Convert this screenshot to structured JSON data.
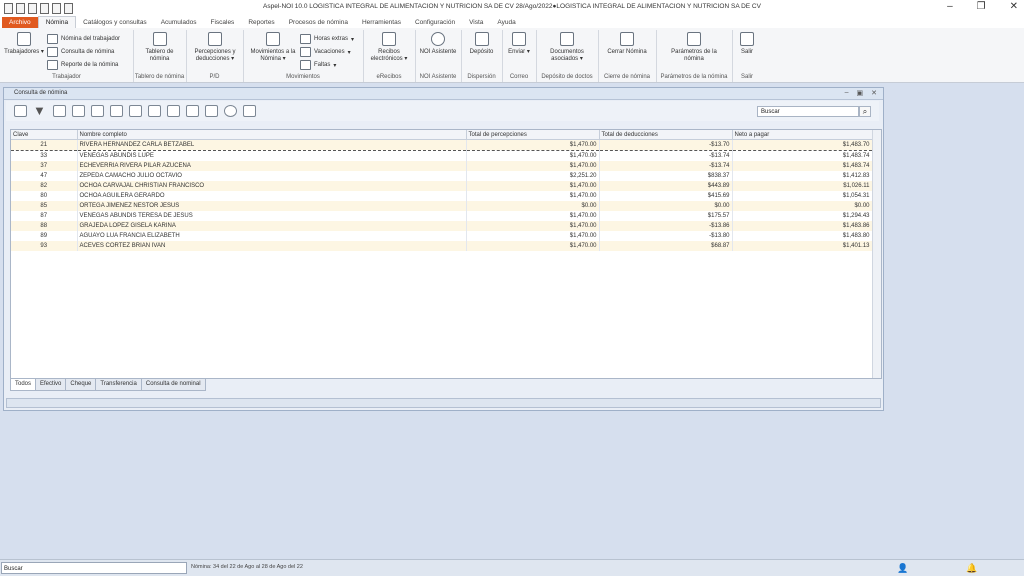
{
  "window": {
    "title": "Aspel-NOI 10.0   LOGISTICA INTEGRAL DE ALIMENTACION Y NUTRICION SA DE CV     28/Ago/2022●LOGISTICA INTEGRAL DE ALIMENTACION Y NUTRICION SA DE CV",
    "minimize": "–",
    "restore": "❐",
    "close": "✕"
  },
  "menu_tabs": [
    "Archivo",
    "Nómina",
    "Catálogos y consultas",
    "Acumulados",
    "Fiscales",
    "Reportes",
    "Procesos de nómina",
    "Herramientas",
    "Configuración",
    "Vista",
    "Ayuda"
  ],
  "ribbon": {
    "trabajador": {
      "trabajadores": "Trabajadores",
      "nomina_trabajador": "Nómina del trabajador",
      "consulta_nomina": "Consulta de nómina",
      "reporte_nomina": "Reporte de la nómina",
      "label": "Trabajador"
    },
    "tablero": {
      "btn": "Tablero de nómina",
      "label": "Tablero de nómina"
    },
    "pd": {
      "btn": "Percepciones y deducciones",
      "label": "P/D"
    },
    "movimientos": {
      "btn": "Movimientos a la Nómina",
      "horas": "Horas extras",
      "vacaciones": "Vacaciones",
      "faltas": "Faltas",
      "label": "Movimientos"
    },
    "recibos": {
      "btn": "Recibos electrónicos",
      "label": "eRecibos"
    },
    "noi": {
      "btn": "NOI Asistente",
      "label": "NOI Asistente"
    },
    "deposito": {
      "btn": "Depósito",
      "label": "Dispersión"
    },
    "enviar": {
      "btn": "Enviar",
      "label": "Correo"
    },
    "documentos": {
      "btn": "Documentos asociados",
      "label": "Depósito de doctos"
    },
    "cerrar": {
      "btn": "Cerrar Nómina",
      "label": "Cierre de nómina"
    },
    "parametros": {
      "btn": "Parámetros de la nómina",
      "label": "Parámetros de la nómina"
    },
    "salir": {
      "btn": "Salir",
      "label": "Salir"
    }
  },
  "panel": {
    "title": "Consulta de nómina",
    "search_placeholder": "Buscar",
    "columns": [
      "Clave",
      "Nombre completo",
      "Total de percepciones",
      "Total de deducciones",
      "Neto a pagar"
    ],
    "rows": [
      [
        "21",
        "RIVERA HERNANDEZ CARLA BETZABEL",
        "$1,470.00",
        "-$13.70",
        "$1,483.70"
      ],
      [
        "33",
        "VENEGAS ABUNDIS LUPE",
        "$1,470.00",
        "-$13.74",
        "$1,483.74"
      ],
      [
        "37",
        "ECHEVERRIA RIVERA PILAR AZUCENA",
        "$1,470.00",
        "-$13.74",
        "$1,483.74"
      ],
      [
        "47",
        "ZEPEDA CAMACHO JULIO OCTAVIO",
        "$2,251.20",
        "$838.37",
        "$1,412.83"
      ],
      [
        "82",
        "OCHOA CARVAJAL CHRISTIAN FRANCISCO",
        "$1,470.00",
        "$443.89",
        "$1,026.11"
      ],
      [
        "80",
        "OCHOA AGUILERA GERARDO",
        "$1,470.00",
        "$415.69",
        "$1,054.31"
      ],
      [
        "85",
        "ORTEGA JIMENEZ NESTOR JESUS",
        "$0.00",
        "$0.00",
        "$0.00"
      ],
      [
        "87",
        "VENEGAS ABUNDIS TERESA DE JESUS",
        "$1,470.00",
        "$175.57",
        "$1,294.43"
      ],
      [
        "88",
        "GRAJEDA LOPEZ GISELA KARINA",
        "$1,470.00",
        "-$13.86",
        "$1,483.86"
      ],
      [
        "89",
        "AGUAYO LUA FRANCIA ELIZABETH",
        "$1,470.00",
        "-$13.80",
        "$1,483.80"
      ],
      [
        "93",
        "ACEVES CORTEZ BRIAN IVAN",
        "$1,470.00",
        "$68.87",
        "$1,401.13"
      ]
    ],
    "bottom_tabs": [
      "Todos",
      "Efectivo",
      "Cheque",
      "Transferencia",
      "Consulta de nominal"
    ]
  },
  "statusbar": {
    "search": "Buscar",
    "nomina_text": "Nómina: 34 del 22 de Ago al 28 de Ago del 22"
  },
  "accent_color": "#e05a20"
}
